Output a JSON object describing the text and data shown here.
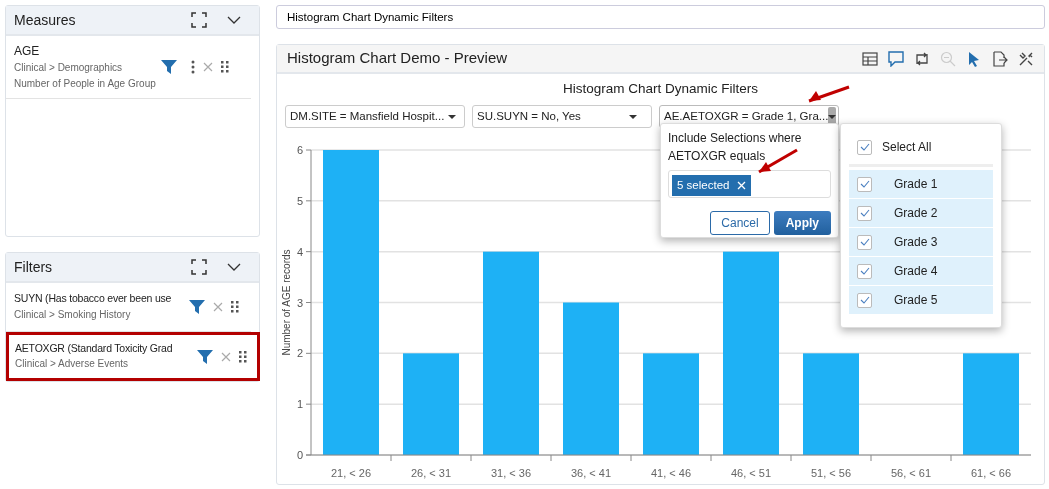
{
  "measures": {
    "title": "Measures",
    "items": [
      {
        "name": "AGE",
        "path": "Clinical > Demographics",
        "description": "Number of People in Age Group"
      }
    ]
  },
  "filters": {
    "title": "Filters",
    "items": [
      {
        "name": "SUYN (Has tobacco ever been use",
        "path": "Clinical > Smoking History",
        "selected": false
      },
      {
        "name": "AETOXGR (Standard Toxicity Grad",
        "path": "Clinical > Adverse Events",
        "selected": true
      }
    ]
  },
  "search": {
    "value": "Histogram Chart Dynamic Filters"
  },
  "preview": {
    "title": "Histogram Chart Demo - Preview",
    "toolbar": [
      {
        "kind": "table",
        "disabled": false
      },
      {
        "kind": "comment",
        "disabled": false
      },
      {
        "kind": "swap",
        "disabled": false
      },
      {
        "kind": "zoom-out",
        "disabled": true
      },
      {
        "kind": "pointer",
        "disabled": false
      },
      {
        "kind": "export",
        "disabled": false
      },
      {
        "kind": "tools",
        "disabled": false
      }
    ],
    "chart_title": "Histogram Chart Dynamic Filters",
    "dropdowns": [
      {
        "label": "DM.SITE = Mansfield Hospit...",
        "open": false
      },
      {
        "label": "SU.SUYN = No, Yes",
        "open": false
      },
      {
        "label": "AE.AETOXGR = Grade 1, Gra...",
        "open": true
      }
    ],
    "popover": {
      "lines": [
        "Include Selections where",
        "AETOXGR equals"
      ],
      "token": "5 selected",
      "cancel": "Cancel",
      "apply": "Apply"
    },
    "checklist": {
      "select_all": {
        "label": "Select All",
        "checked": true
      },
      "options": [
        {
          "label": "Grade 1",
          "checked": true
        },
        {
          "label": "Grade 2",
          "checked": true
        },
        {
          "label": "Grade 3",
          "checked": true
        },
        {
          "label": "Grade 4",
          "checked": true
        },
        {
          "label": "Grade 5",
          "checked": true
        }
      ]
    },
    "chart_data": {
      "type": "bar",
      "ylabel": "Number of AGE records",
      "categories": [
        "21, < 26",
        "26, < 31",
        "31, < 36",
        "36, < 41",
        "41, < 46",
        "46, < 51",
        "51, < 56",
        "56, < 61",
        "61, < 66"
      ],
      "grid": true,
      "series": [
        {
          "color": "#1eb1f5",
          "values": [
            6,
            2,
            4,
            3,
            2,
            4,
            2,
            0,
            2
          ]
        }
      ],
      "ylim": [
        0,
        6
      ],
      "yticks": [
        0,
        1,
        2,
        3,
        4,
        5,
        6
      ]
    }
  }
}
